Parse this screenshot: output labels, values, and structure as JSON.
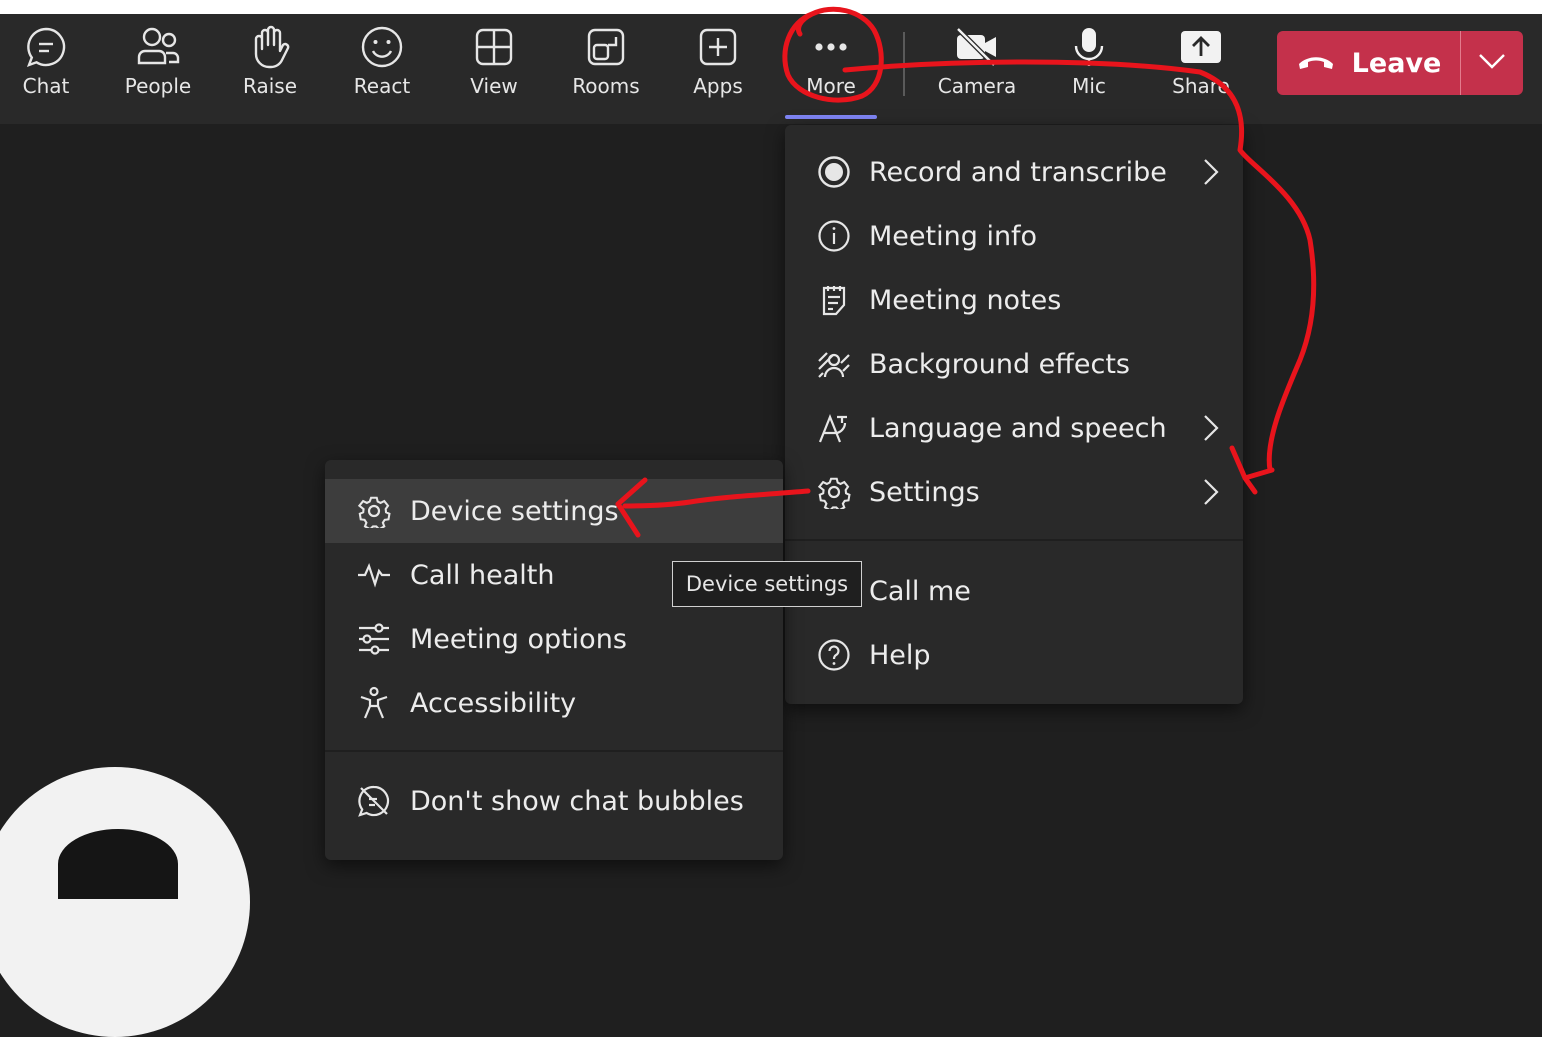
{
  "toolbar": {
    "buttons": [
      {
        "label": "Chat",
        "icon": "chat-icon"
      },
      {
        "label": "People",
        "icon": "people-icon"
      },
      {
        "label": "Raise",
        "icon": "raise-hand-icon"
      },
      {
        "label": "React",
        "icon": "smile-icon"
      },
      {
        "label": "View",
        "icon": "grid-icon"
      },
      {
        "label": "Rooms",
        "icon": "rooms-icon"
      },
      {
        "label": "Apps",
        "icon": "add-app-icon"
      },
      {
        "label": "More",
        "icon": "more-icon"
      },
      {
        "label": "Camera",
        "icon": "camera-off-icon"
      },
      {
        "label": "Mic",
        "icon": "mic-icon"
      },
      {
        "label": "Share",
        "icon": "share-icon"
      }
    ],
    "leave_label": "Leave"
  },
  "more_menu": {
    "items": [
      {
        "label": "Record and transcribe",
        "icon": "record-icon"
      },
      {
        "label": "Meeting info",
        "icon": "info-icon"
      },
      {
        "label": "Meeting notes",
        "icon": "notes-icon"
      },
      {
        "label": "Background effects",
        "icon": "background-effects-icon"
      },
      {
        "label": "Language and speech",
        "icon": "language-icon"
      },
      {
        "label": "Settings",
        "icon": "gear-icon"
      },
      {
        "label": "Call me",
        "icon": "phone-icon"
      },
      {
        "label": "Help",
        "icon": "help-icon"
      }
    ]
  },
  "settings_menu": {
    "items": [
      {
        "label": "Device settings",
        "icon": "gear-icon"
      },
      {
        "label": "Call health",
        "icon": "pulse-icon"
      },
      {
        "label": "Meeting options",
        "icon": "sliders-icon"
      },
      {
        "label": "Accessibility",
        "icon": "accessibility-icon"
      },
      {
        "label": "Don't show chat bubbles",
        "icon": "chat-off-icon"
      }
    ]
  },
  "tooltip": "Device settings",
  "colors": {
    "leave": "#c4314b",
    "accent": "#7f85f5",
    "annotation": "#e8141c"
  }
}
